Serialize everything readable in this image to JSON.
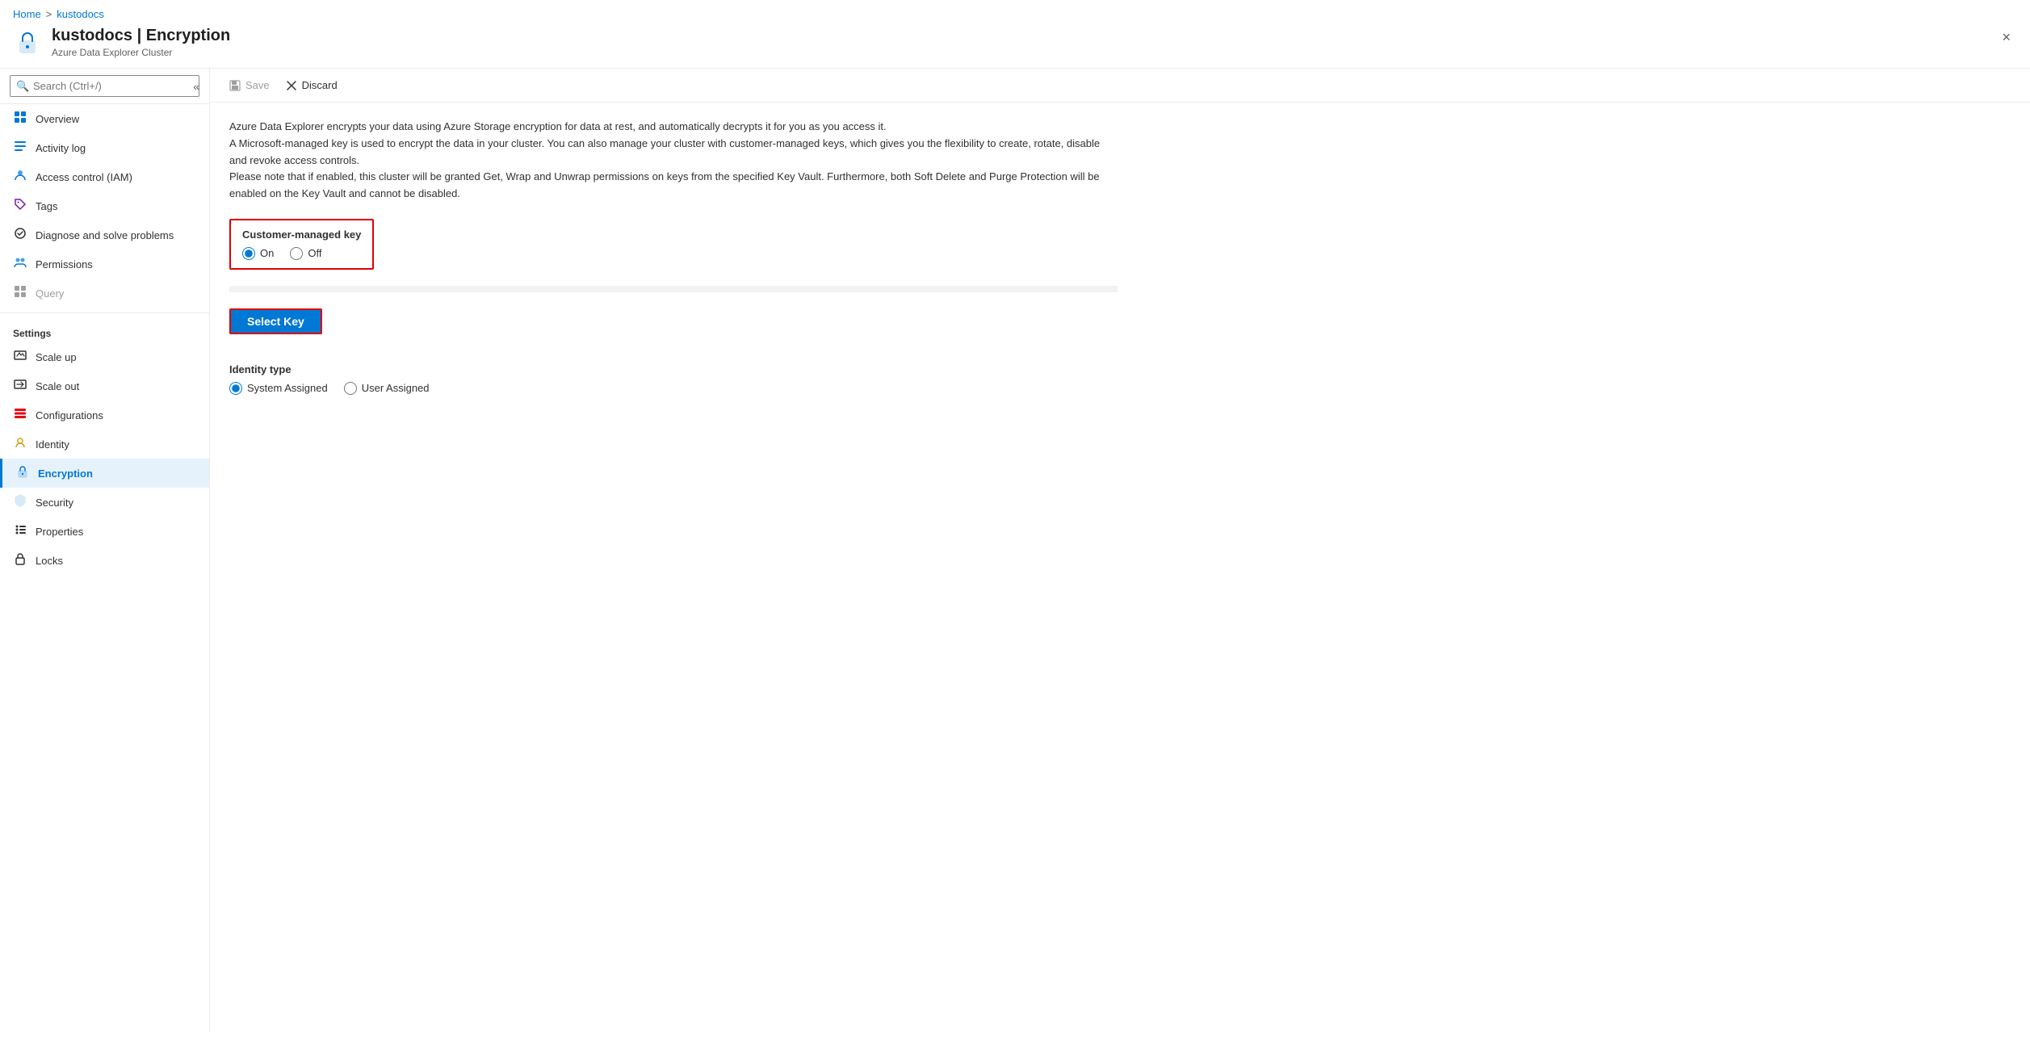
{
  "breadcrumb": {
    "home": "Home",
    "separator": ">",
    "current": "kustodocs"
  },
  "header": {
    "title": "kustodocs | Encryption",
    "subtitle": "Azure Data Explorer Cluster",
    "close_label": "×"
  },
  "sidebar": {
    "search_placeholder": "Search (Ctrl+/)",
    "collapse_icon": "«",
    "items": [
      {
        "id": "overview",
        "label": "Overview",
        "icon": "⊞",
        "active": false,
        "disabled": false
      },
      {
        "id": "activity-log",
        "label": "Activity log",
        "icon": "≡",
        "active": false,
        "disabled": false
      },
      {
        "id": "access-control",
        "label": "Access control (IAM)",
        "icon": "👤",
        "active": false,
        "disabled": false
      },
      {
        "id": "tags",
        "label": "Tags",
        "icon": "🏷",
        "active": false,
        "disabled": false
      },
      {
        "id": "diagnose",
        "label": "Diagnose and solve problems",
        "icon": "🔧",
        "active": false,
        "disabled": false
      },
      {
        "id": "permissions",
        "label": "Permissions",
        "icon": "👥",
        "active": false,
        "disabled": false
      },
      {
        "id": "query",
        "label": "Query",
        "icon": "⊞",
        "active": false,
        "disabled": true
      }
    ],
    "settings_label": "Settings",
    "settings_items": [
      {
        "id": "scale-up",
        "label": "Scale up",
        "icon": "↑",
        "active": false,
        "disabled": false
      },
      {
        "id": "scale-out",
        "label": "Scale out",
        "icon": "↔",
        "active": false,
        "disabled": false
      },
      {
        "id": "configurations",
        "label": "Configurations",
        "icon": "⊟",
        "active": false,
        "disabled": false
      },
      {
        "id": "identity",
        "label": "Identity",
        "icon": "🔑",
        "active": false,
        "disabled": false
      },
      {
        "id": "encryption",
        "label": "Encryption",
        "icon": "🔒",
        "active": true,
        "disabled": false
      },
      {
        "id": "security",
        "label": "Security",
        "icon": "🛡",
        "active": false,
        "disabled": false
      },
      {
        "id": "properties",
        "label": "Properties",
        "icon": "≡",
        "active": false,
        "disabled": false
      },
      {
        "id": "locks",
        "label": "Locks",
        "icon": "🔒",
        "active": false,
        "disabled": false
      }
    ]
  },
  "toolbar": {
    "save_label": "Save",
    "discard_label": "Discard"
  },
  "content": {
    "description_line1": "Azure Data Explorer encrypts your data using Azure Storage encryption for data at rest, and automatically decrypts it for you as you access it.",
    "description_line2": "A Microsoft-managed key is used to encrypt the data in your cluster. You can also manage your cluster with customer-managed keys, which gives you the flexibility to create, rotate, disable and revoke access controls.",
    "description_line3": "Please note that if enabled, this cluster will be granted Get, Wrap and Unwrap permissions on keys from the specified Key Vault. Furthermore, both Soft Delete and Purge Protection will be enabled on the Key Vault and cannot be disabled.",
    "customer_managed_key_label": "Customer-managed key",
    "radio_on_label": "On",
    "radio_off_label": "Off",
    "select_key_label": "Select Key",
    "identity_type_label": "Identity type",
    "system_assigned_label": "System Assigned",
    "user_assigned_label": "User Assigned"
  }
}
